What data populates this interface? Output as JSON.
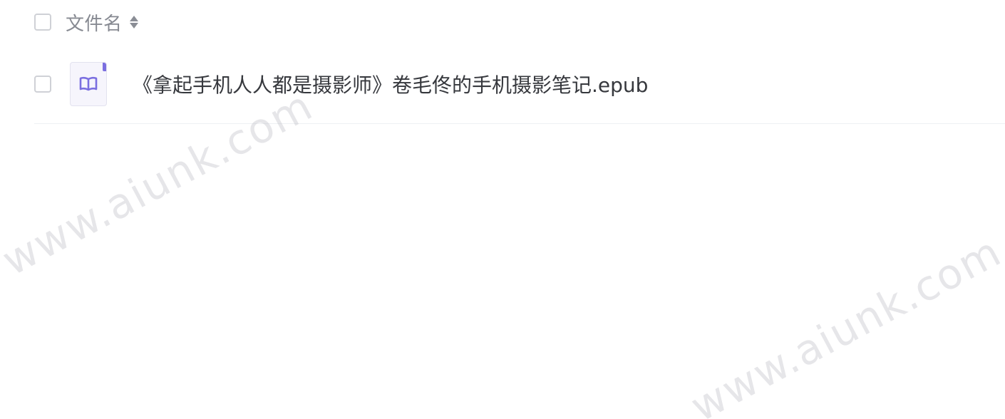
{
  "header": {
    "filename_label": "文件名"
  },
  "files": [
    {
      "name": "《拿起手机人人都是摄影师》卷毛佟的手机摄影笔记.epub",
      "icon": "book-icon"
    }
  ],
  "watermarks": [
    "www.aiunk.com",
    "www.aiunk.com"
  ],
  "colors": {
    "accent": "#7b6fe0",
    "text": "#36383d",
    "header_text": "#878a92"
  }
}
